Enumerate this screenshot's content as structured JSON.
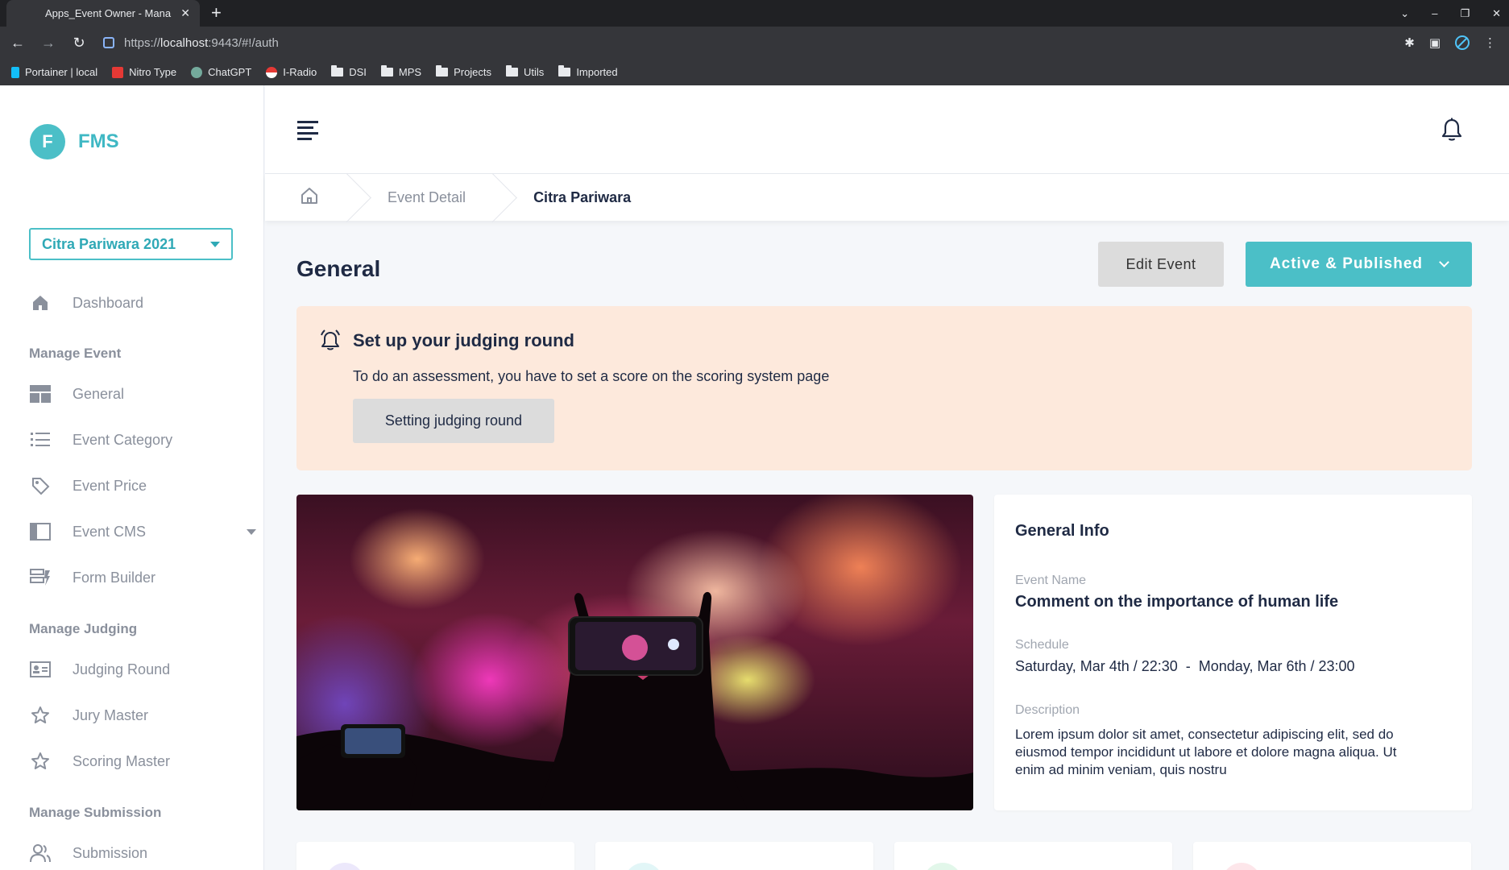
{
  "browser": {
    "tab_title": "Apps_Event Owner - Mana",
    "tab_close": "✕",
    "new_tab": "+",
    "url_prefix": "https://",
    "url_host": "localhost",
    "url_rest": ":9443/#!/auth",
    "bookmarks": [
      {
        "label": "Portainer | local",
        "icon": "portainer-icon",
        "color": "#13bef9"
      },
      {
        "label": "Nitro Type",
        "icon": "nitro-type-icon",
        "color": "#e53935"
      },
      {
        "label": "ChatGPT",
        "icon": "chatgpt-icon",
        "color": "#74aa9c"
      },
      {
        "label": "I-Radio",
        "icon": "i-radio-icon",
        "color": "#e53935"
      },
      {
        "label": "DSI",
        "icon": "folder-icon"
      },
      {
        "label": "MPS",
        "icon": "folder-icon"
      },
      {
        "label": "Projects",
        "icon": "folder-icon"
      },
      {
        "label": "Utils",
        "icon": "folder-icon"
      },
      {
        "label": "Imported",
        "icon": "folder-icon"
      }
    ]
  },
  "brand": {
    "logo_letter": "F",
    "name": "FMS",
    "color": "#4bbfc7"
  },
  "event_selector": {
    "value": "Citra Pariwara 2021"
  },
  "sidebar": {
    "dashboard": "Dashboard",
    "sections": {
      "manage_event": "Manage Event",
      "manage_judging": "Manage Judging",
      "manage_submission": "Manage Submission"
    },
    "items": {
      "general": "General",
      "event_category": "Event Category",
      "event_price": "Event Price",
      "event_cms": "Event CMS",
      "form_builder": "Form Builder",
      "judging_round": "Judging Round",
      "jury_master": "Jury Master",
      "scoring_master": "Scoring Master",
      "submission": "Submission"
    }
  },
  "breadcrumb": {
    "items": [
      "Event Detail",
      "Citra Pariwara"
    ]
  },
  "page": {
    "title": "General",
    "edit_button": "Edit Event",
    "status_button": "Active & Published"
  },
  "alert": {
    "title": "Set up your judging round",
    "text": "To do an assessment, you have to set a score on the scoring system page",
    "button": "Setting judging round"
  },
  "general_info": {
    "title": "General Info",
    "event_name_label": "Event Name",
    "event_name": "Comment on the importance of human life",
    "schedule_label": "Schedule",
    "schedule": "Saturday, Mar 4th / 22:30  -  Monday, Mar 6th / 23:00",
    "description_label": "Description",
    "description": "Lorem ipsum dolor sit amet, consectetur adipiscing elit, sed do eiusmod tempor incididunt ut labore et dolore magna aliqua. Ut enim ad minim veniam, quis nostru"
  },
  "stat_cards": [
    {
      "color": "#ece8fb"
    },
    {
      "color": "#e2f6f7"
    },
    {
      "color": "#e2f7ea"
    },
    {
      "color": "#fde6ea"
    }
  ],
  "colors": {
    "accent": "#4bbfc7",
    "alert_bg": "#fde9dc",
    "sidebar_text": "#8a909c"
  }
}
